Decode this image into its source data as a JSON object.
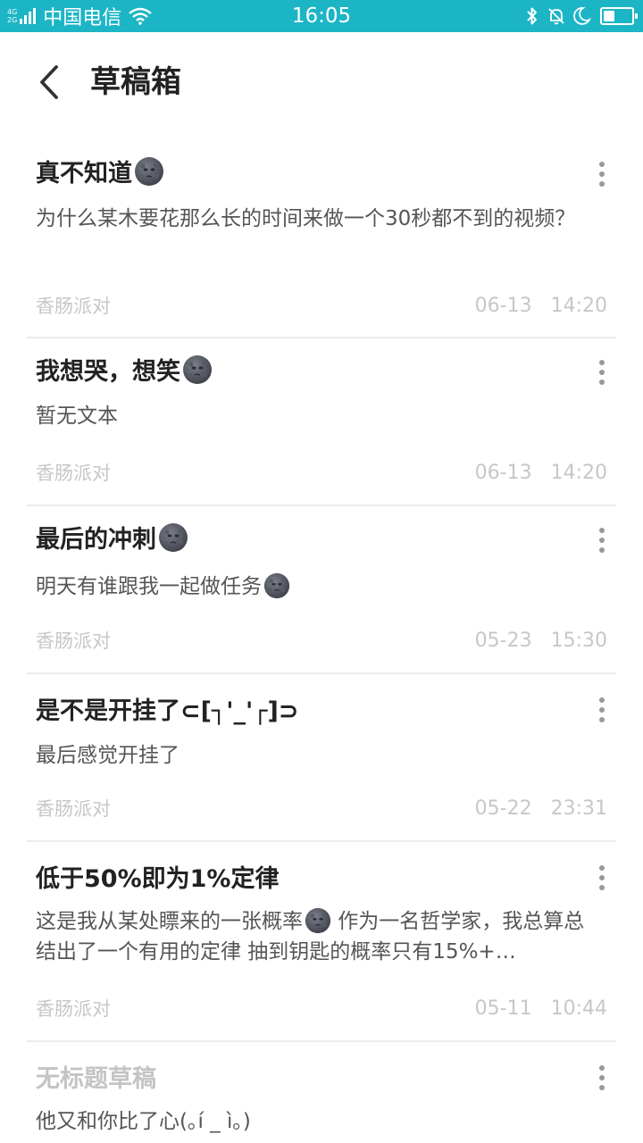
{
  "status_bar": {
    "network_top": "4G",
    "network_bottom": "2G",
    "carrier": "中国电信",
    "time": "16:05",
    "battery_level": 0.4
  },
  "header": {
    "title": "草稿箱",
    "back_icon": "chevron-left-icon"
  },
  "colors": {
    "status_bar": "#1cb5c6",
    "title_text": "#222222",
    "meta_text": "#c7c7c7",
    "divider": "#ececec"
  },
  "drafts": [
    {
      "title": "真不知道",
      "title_emoji": "new-moon-face-icon",
      "body": "为什么某木要花那么长的时间来做一个30秒都不到的视频？",
      "source": "香肠派对",
      "date": "06-13",
      "time": "14:20"
    },
    {
      "title": "我想哭，想笑",
      "title_emoji": "new-moon-face-icon",
      "body": "暂无文本",
      "source": "香肠派对",
      "date": "06-13",
      "time": "14:20"
    },
    {
      "title": "最后的冲刺",
      "title_emoji": "new-moon-face-icon",
      "body": "明天有谁跟我一起做任务",
      "body_emoji": "new-moon-face-icon",
      "source": "香肠派对",
      "date": "05-23",
      "time": "15:30"
    },
    {
      "title": "是不是开挂了⊂[┐'_'┌]⊃",
      "body": "最后感觉开挂了",
      "source": "香肠派对",
      "date": "05-22",
      "time": "23:31"
    },
    {
      "title": "低于50%即为1%定律",
      "body_before": "这是我从某处瞟来的一张概率",
      "body_after": " 作为一名哲学家，我总算总结出了一个有用的定律 抽到钥匙的概率只有15%+…",
      "source": "香肠派对",
      "date": "05-11",
      "time": "10:44"
    },
    {
      "title": "无标题草稿",
      "body": "他又和你比了心(｡í _ ì｡)"
    }
  ]
}
